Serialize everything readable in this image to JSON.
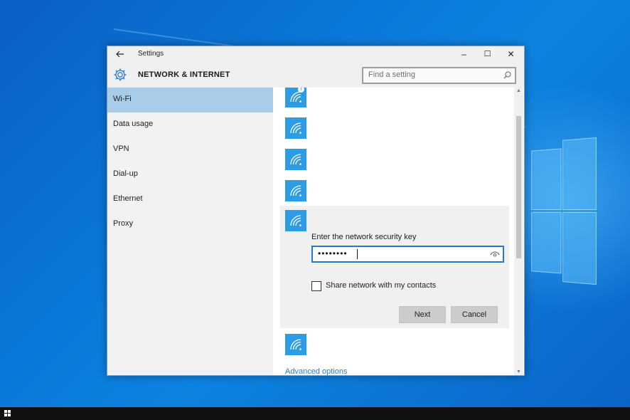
{
  "window": {
    "title": "Settings",
    "back_icon": "back-arrow-icon",
    "minimize_glyph": "–",
    "maximize_glyph": "☐",
    "close_glyph": "✕"
  },
  "header": {
    "title": "NETWORK & INTERNET",
    "icon": "gear-icon",
    "search_placeholder": "Find a setting",
    "search_icon": "search-icon"
  },
  "sidebar": {
    "items": [
      {
        "label": "Wi-Fi",
        "active": true
      },
      {
        "label": "Data usage",
        "active": false
      },
      {
        "label": "VPN",
        "active": false
      },
      {
        "label": "Dial-up",
        "active": false
      },
      {
        "label": "Ethernet",
        "active": false
      },
      {
        "label": "Proxy",
        "active": false
      }
    ]
  },
  "networks": {
    "icon": "wifi-icon",
    "warning_icon": "warning-icon"
  },
  "connect_panel": {
    "key_label": "Enter the network security key",
    "password_value": "••••••••",
    "reveal_icon": "eye-icon",
    "share_label": "Share network with my contacts",
    "share_checked": false,
    "next_label": "Next",
    "cancel_label": "Cancel"
  },
  "advanced_link": "Advanced options",
  "colors": {
    "accent": "#2d9ce6",
    "active_nav": "#a9cde9",
    "desktop": "#0a78d8"
  }
}
